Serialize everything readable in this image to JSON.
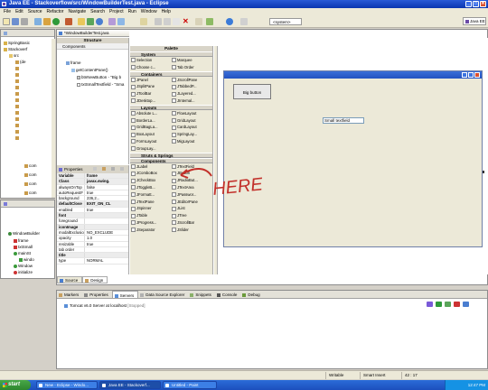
{
  "window": {
    "title": "Java EE - Stackoverflow/src/WindowBuilderTest.java - Eclipse",
    "buttons": [
      "_",
      "□",
      "✕"
    ]
  },
  "menu": [
    "File",
    "Edit",
    "Source",
    "Refactor",
    "Navigate",
    "Search",
    "Project",
    "Run",
    "Window",
    "Help"
  ],
  "toolbar": {
    "system_dropdown": "<system>",
    "perspective": "Java EE"
  },
  "left_tree": {
    "items": [
      "SpringBasic",
      "Stackoverf",
      "src",
      "(de",
      "com",
      "com",
      "com",
      "com",
      "com",
      "com",
      "com",
      "com",
      "com",
      "com",
      "com",
      "com"
    ]
  },
  "outline": {
    "items": [
      "WindowBuilder",
      "frame",
      "txtSmall",
      "mainSt",
      "windo",
      "Window",
      "initialize"
    ]
  },
  "editor": {
    "tab": "*WindowBuilderTest.java",
    "structure_label": "Structure",
    "components_label": "Components",
    "tree": [
      "frame",
      "getContentPane()",
      "btnNewButton - \"Big b",
      "txtSmallTextfield - \"Sma"
    ],
    "properties_label": "Properties",
    "properties": [
      {
        "name": "Variable",
        "value": "frame",
        "cat": true
      },
      {
        "name": "Class",
        "value": "javax.swing.",
        "cat": true
      },
      {
        "name": "alwaysOnTop",
        "value": "false",
        "cat": false
      },
      {
        "name": "autoRequestF",
        "value": "true",
        "cat": false
      },
      {
        "name": "background",
        "value": "236,2...",
        "cat": false
      },
      {
        "name": "defaultClose",
        "value": "EXIT_ON_CL",
        "cat": true
      },
      {
        "name": "enabled",
        "value": "true",
        "cat": false
      },
      {
        "name": "font",
        "value": "",
        "cat": true
      },
      {
        "name": "foreground",
        "value": "",
        "cat": false
      },
      {
        "name": "iconImage",
        "value": "",
        "cat": true
      },
      {
        "name": "modalExclusion",
        "value": "NO_EXCLUDE",
        "cat": false
      },
      {
        "name": "opacity",
        "value": "1.0",
        "cat": false
      },
      {
        "name": "resizable",
        "value": "true",
        "cat": false
      },
      {
        "name": "tab order",
        "value": "",
        "cat": false
      },
      {
        "name": "title",
        "value": "",
        "cat": true
      },
      {
        "name": "type",
        "value": "NORMAL",
        "cat": false
      }
    ],
    "palette_label": "Palette",
    "palette_sections": [
      {
        "title": "System",
        "items": [
          [
            "Selection",
            "Marquee"
          ],
          [
            "Choose c...",
            "Tab Order"
          ]
        ]
      },
      {
        "title": "Containers",
        "items": [
          [
            "JPanel",
            "JScrollPane"
          ],
          [
            "JSplitPane",
            "JTabbedP..."
          ],
          [
            "JToolBar",
            "JLayered..."
          ],
          [
            "JDesktop...",
            "JInternal..."
          ]
        ]
      },
      {
        "title": "Layouts",
        "items": [
          [
            "Absolute L...",
            "FlowLayout"
          ],
          [
            "BorderLa...",
            "GridLayout"
          ],
          [
            "GridBagLa...",
            "CardLayout"
          ],
          [
            "BoxLayout",
            "SpringLay..."
          ],
          [
            "FormLayout",
            "MigLayout"
          ],
          [
            "GroupLay...",
            ""
          ]
        ]
      },
      {
        "title": "Struts & Springs",
        "items": []
      },
      {
        "title": "Components",
        "items": [
          [
            "JLabel",
            "JTextField"
          ],
          [
            "JComboBox",
            "JButton"
          ],
          [
            "JCheckBox",
            "JRadioBut..."
          ],
          [
            "JToggleB...",
            "JTextArea"
          ],
          [
            "JFormatt...",
            "JPasswor..."
          ],
          [
            "JTextPane",
            "JEditorPane"
          ],
          [
            "JSpinner",
            "JList"
          ],
          [
            "JTable",
            "JTree"
          ],
          [
            "JProgress...",
            "JScrollBar"
          ],
          [
            "JSeparator",
            "JSlider"
          ]
        ]
      }
    ],
    "design": {
      "button_label": "Big button",
      "textfield_value": "Small textfield"
    },
    "bottom_tabs": [
      "Source",
      "Design"
    ]
  },
  "annotation": {
    "text": "HERE",
    "color": "#c2302a"
  },
  "console_panel": {
    "tabs": [
      "Markers",
      "Properties",
      "Servers",
      "Data Source Explorer",
      "Snippets",
      "Console",
      "Debug"
    ],
    "active_tab": "Servers",
    "server_entry": "Tomcat v6.0 Server at localhost",
    "server_status": "[Stopped]"
  },
  "status": {
    "mode": "Writable",
    "insert": "Smart Insert",
    "position": "42 : 17"
  },
  "taskbar": {
    "start": "start",
    "tasks": [
      "New - Eclipse - Windo...",
      "Java EE - Stackoverf...",
      "Untitled - Paint"
    ],
    "clock": "12:47 PM"
  }
}
